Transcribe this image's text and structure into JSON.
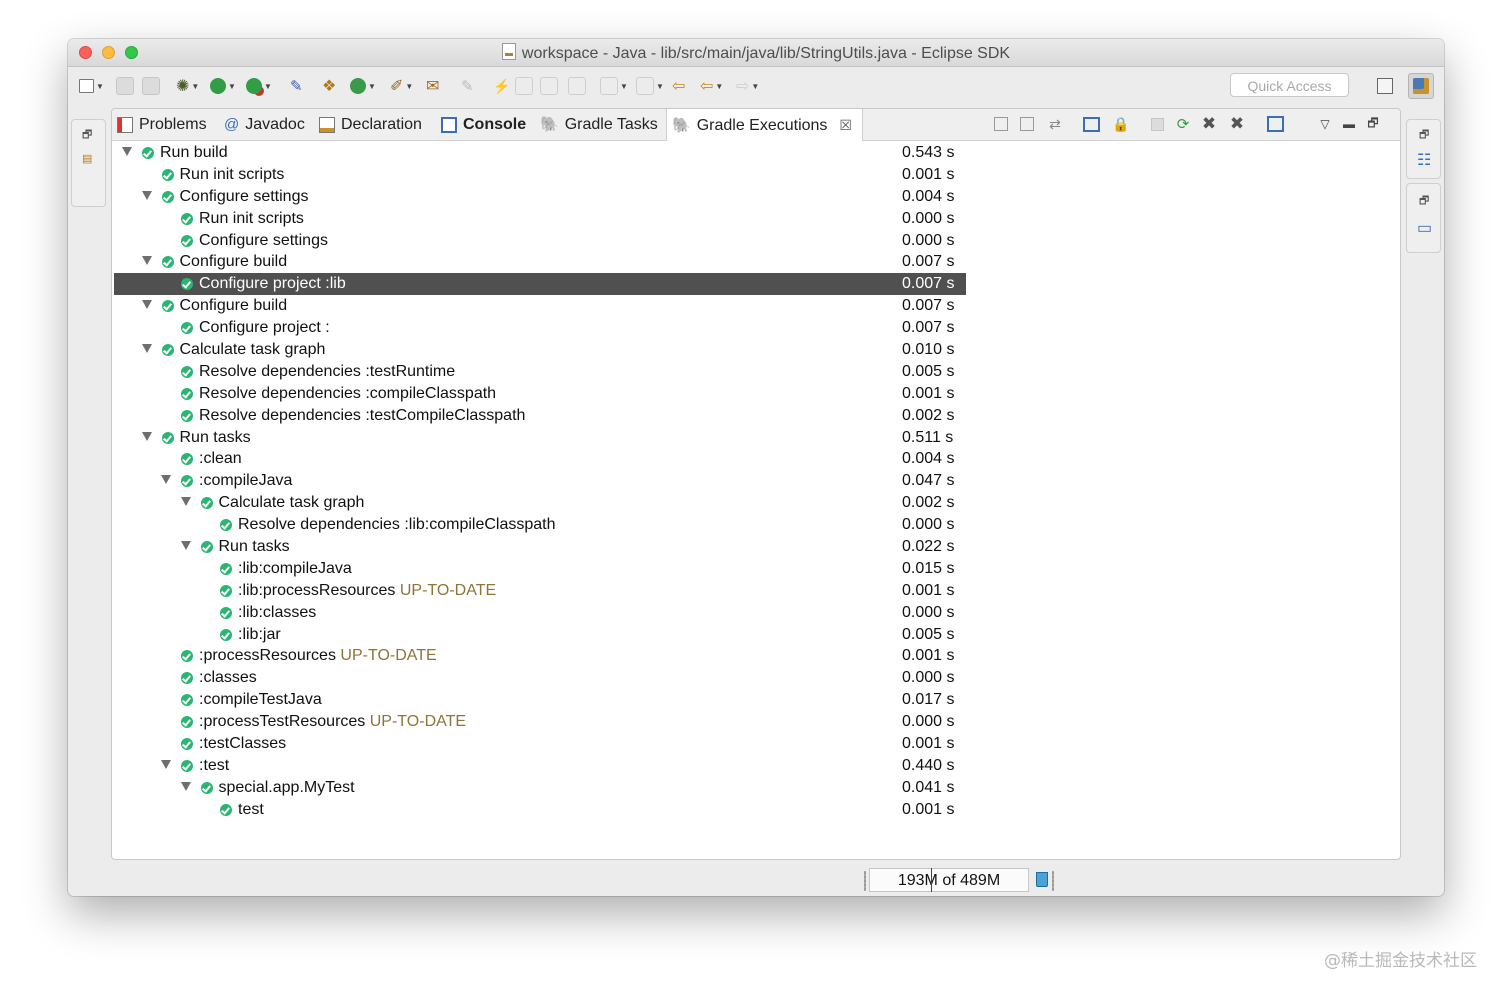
{
  "window": {
    "title": "workspace - Java - lib/src/main/java/lib/StringUtils.java - Eclipse SDK"
  },
  "toolbar": {
    "quick_access_placeholder": "Quick Access",
    "icons": [
      "new-wizard-icon",
      "save-icon",
      "save-all-icon",
      "debug-icon",
      "run-icon",
      "external-tools-icon",
      "toggle-mark-icon",
      "new-java-package-icon",
      "new-java-class-icon",
      "search-icon",
      "open-type-icon",
      "annotation-icon",
      "next-edit-icon",
      "back-icon",
      "forward-icon",
      "open-perspective-icon",
      "java-perspective-icon"
    ]
  },
  "tabs": [
    {
      "label": "Problems",
      "icon": "problems-icon"
    },
    {
      "label": "Javadoc",
      "icon": "javadoc-icon"
    },
    {
      "label": "Declaration",
      "icon": "declaration-icon"
    },
    {
      "label": "Console",
      "icon": "console-icon"
    },
    {
      "label": "Gradle Tasks",
      "icon": "gradle-icon"
    },
    {
      "label": "Gradle Executions",
      "icon": "gradle-icon",
      "active": true
    }
  ],
  "tree": [
    {
      "depth": 0,
      "expanded": true,
      "label": "Run build",
      "tag": "",
      "duration": "0.543 s"
    },
    {
      "depth": 1,
      "expanded": false,
      "label": "Run init scripts",
      "tag": "",
      "duration": "0.001 s"
    },
    {
      "depth": 1,
      "expanded": true,
      "label": "Configure settings",
      "tag": "",
      "duration": "0.004 s"
    },
    {
      "depth": 2,
      "expanded": false,
      "label": "Run init scripts",
      "tag": "",
      "duration": "0.000 s"
    },
    {
      "depth": 2,
      "expanded": false,
      "label": "Configure settings",
      "tag": "",
      "duration": "0.000 s"
    },
    {
      "depth": 1,
      "expanded": true,
      "label": "Configure build",
      "tag": "",
      "duration": "0.007 s"
    },
    {
      "depth": 2,
      "expanded": false,
      "label": "Configure project :lib",
      "tag": "",
      "duration": "0.007 s",
      "selected": true
    },
    {
      "depth": 1,
      "expanded": true,
      "label": "Configure build",
      "tag": "",
      "duration": "0.007 s"
    },
    {
      "depth": 2,
      "expanded": false,
      "label": "Configure project :",
      "tag": "",
      "duration": "0.007 s"
    },
    {
      "depth": 1,
      "expanded": true,
      "label": "Calculate task graph",
      "tag": "",
      "duration": "0.010 s"
    },
    {
      "depth": 2,
      "expanded": false,
      "label": "Resolve dependencies :testRuntime",
      "tag": "",
      "duration": "0.005 s"
    },
    {
      "depth": 2,
      "expanded": false,
      "label": "Resolve dependencies :compileClasspath",
      "tag": "",
      "duration": "0.001 s"
    },
    {
      "depth": 2,
      "expanded": false,
      "label": "Resolve dependencies :testCompileClasspath",
      "tag": "",
      "duration": "0.002 s"
    },
    {
      "depth": 1,
      "expanded": true,
      "label": "Run tasks",
      "tag": "",
      "duration": "0.511 s"
    },
    {
      "depth": 2,
      "expanded": false,
      "label": ":clean",
      "tag": "",
      "duration": "0.004 s"
    },
    {
      "depth": 2,
      "expanded": true,
      "label": ":compileJava",
      "tag": "",
      "duration": "0.047 s"
    },
    {
      "depth": 3,
      "expanded": true,
      "label": "Calculate task graph",
      "tag": "",
      "duration": "0.002 s"
    },
    {
      "depth": 4,
      "expanded": false,
      "label": "Resolve dependencies :lib:compileClasspath",
      "tag": "",
      "duration": "0.000 s"
    },
    {
      "depth": 3,
      "expanded": true,
      "label": "Run tasks",
      "tag": "",
      "duration": "0.022 s"
    },
    {
      "depth": 4,
      "expanded": false,
      "label": ":lib:compileJava",
      "tag": "",
      "duration": "0.015 s"
    },
    {
      "depth": 4,
      "expanded": false,
      "label": ":lib:processResources",
      "tag": "UP-TO-DATE",
      "duration": "0.001 s"
    },
    {
      "depth": 4,
      "expanded": false,
      "label": ":lib:classes",
      "tag": "",
      "duration": "0.000 s"
    },
    {
      "depth": 4,
      "expanded": false,
      "label": ":lib:jar",
      "tag": "",
      "duration": "0.005 s"
    },
    {
      "depth": 2,
      "expanded": false,
      "label": ":processResources",
      "tag": "UP-TO-DATE",
      "duration": "0.001 s"
    },
    {
      "depth": 2,
      "expanded": false,
      "label": ":classes",
      "tag": "",
      "duration": "0.000 s"
    },
    {
      "depth": 2,
      "expanded": false,
      "label": ":compileTestJava",
      "tag": "",
      "duration": "0.017 s"
    },
    {
      "depth": 2,
      "expanded": false,
      "label": ":processTestResources",
      "tag": "UP-TO-DATE",
      "duration": "0.000 s"
    },
    {
      "depth": 2,
      "expanded": false,
      "label": ":testClasses",
      "tag": "",
      "duration": "0.001 s"
    },
    {
      "depth": 2,
      "expanded": true,
      "label": ":test",
      "tag": "",
      "duration": "0.440 s"
    },
    {
      "depth": 3,
      "expanded": true,
      "label": "special.app.MyTest",
      "tag": "",
      "duration": "0.041 s"
    },
    {
      "depth": 4,
      "expanded": false,
      "label": "test",
      "tag": "",
      "duration": "0.001 s"
    }
  ],
  "status": {
    "heap": "193M of 489M",
    "heap_fraction": 0.39
  },
  "watermark": "@稀土掘金技术社区",
  "colors": {
    "success": "#2ab573",
    "selection": "#505050",
    "up_to_date": "#8f7437"
  }
}
